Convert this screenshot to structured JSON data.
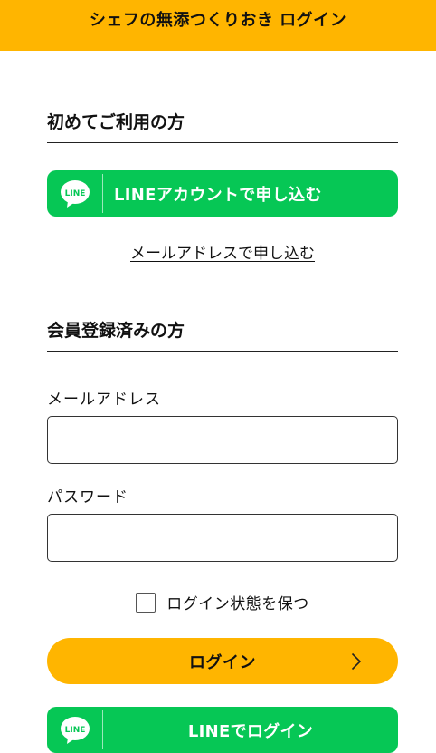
{
  "header": {
    "title": "シェフの無添つくりおき ログイン"
  },
  "new_user": {
    "title": "初めてご利用の方",
    "line_signup_label": "LINEアカウントで申し込む",
    "line_icon_text": "LINE",
    "email_signup_label": "メールアドレスで申し込む"
  },
  "member": {
    "title": "会員登録済みの方",
    "email_label": "メールアドレス",
    "email_value": "",
    "password_label": "パスワード",
    "password_value": "",
    "remember_label": "ログイン状態を保つ",
    "remember_checked": false,
    "login_label": "ログイン",
    "line_login_label": "LINEでログイン",
    "line_icon_text": "LINE"
  },
  "colors": {
    "brand_yellow": "#FFB500",
    "line_green": "#06C755"
  }
}
